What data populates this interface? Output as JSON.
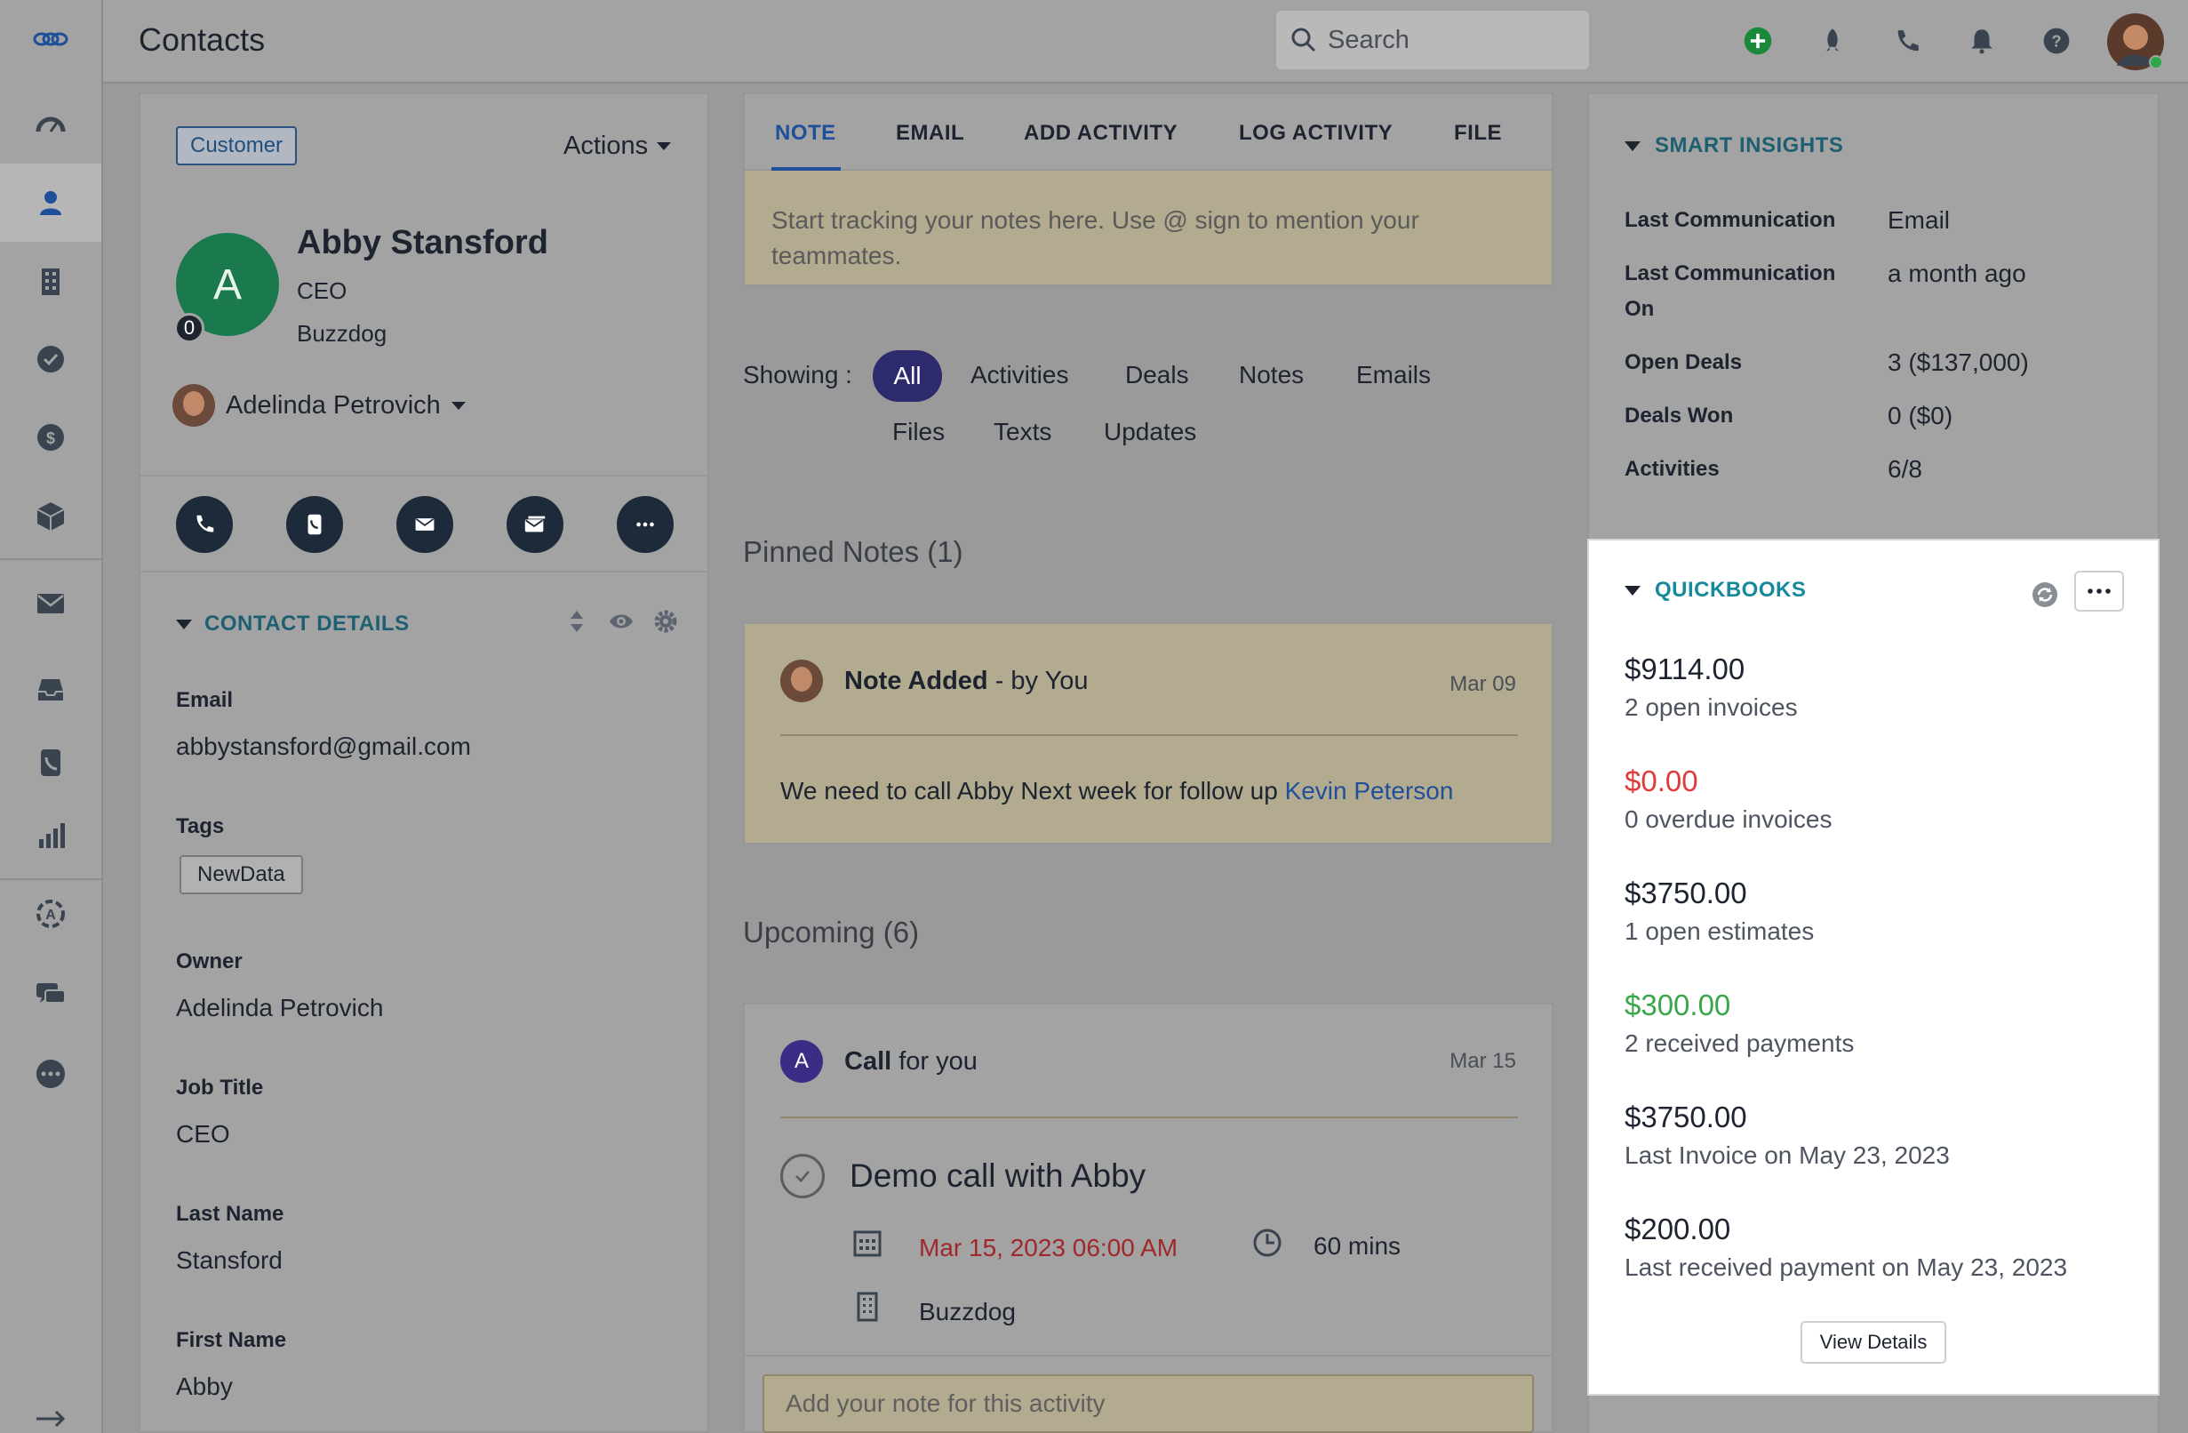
{
  "topbar": {
    "title": "Contacts",
    "search_placeholder": "Search"
  },
  "left_nav": {
    "items": [
      "logo-icon",
      "dashboard-icon",
      "contacts-icon",
      "accounts-icon",
      "tasks-icon",
      "deals-icon",
      "products-icon",
      "email-icon",
      "inbox-icon",
      "phone-log-icon",
      "reports-icon",
      "automation-icon",
      "chat-icon",
      "more-icon",
      "expand-icon"
    ]
  },
  "contact": {
    "badge": "Customer",
    "actions_label": "Actions",
    "avatar_initial": "A",
    "score": "0",
    "name": "Abby Stansford",
    "title": "CEO",
    "company": "Buzzdog",
    "owner": "Adelinda Petrovich"
  },
  "contact_details": {
    "header": "CONTACT DETAILS",
    "email_label": "Email",
    "email": "abbystansford@gmail.com",
    "tags_label": "Tags",
    "tag": "NewData",
    "owner_label": "Owner",
    "owner": "Adelinda Petrovich",
    "job_title_label": "Job Title",
    "job_title": "CEO",
    "last_name_label": "Last Name",
    "last_name": "Stansford",
    "first_name_label": "First Name",
    "first_name": "Abby"
  },
  "composer": {
    "tabs": [
      "NOTE",
      "EMAIL",
      "ADD ACTIVITY",
      "LOG ACTIVITY",
      "FILE"
    ],
    "placeholder_line1": "Start tracking your notes here. Use @ sign to mention your",
    "placeholder_line2": "teammates."
  },
  "filters": {
    "showing_label": "Showing :",
    "items": [
      "All",
      "Activities",
      "Deals",
      "Notes",
      "Emails",
      "Files",
      "Texts",
      "Updates"
    ]
  },
  "pinned": {
    "title": "Pinned Notes (1)",
    "note_title": "Note Added",
    "note_by": " - by You",
    "note_date": "Mar 09",
    "note_text": "We need to call Abby Next week for follow up ",
    "mention": "Kevin Peterson"
  },
  "upcoming": {
    "title": "Upcoming (6)",
    "avatar_initial": "A",
    "type": "Call",
    "for": " for you",
    "date": "Mar 15",
    "activity_title": "Demo call with Abby",
    "datetime": "Mar 15, 2023 06:00 AM",
    "duration": "60 mins",
    "company": "Buzzdog",
    "note_placeholder": "Add your note for this activity"
  },
  "smart_insights": {
    "header": "SMART INSIGHTS",
    "rows": [
      {
        "label": "Last Communication",
        "value": "Email"
      },
      {
        "label": "Last Communication On",
        "value": "a month ago"
      },
      {
        "label": "Open Deals",
        "value": "3 ($137,000)"
      },
      {
        "label": "Deals Won",
        "value": "0 ($0)"
      },
      {
        "label": "Activities",
        "value": "6/8"
      }
    ]
  },
  "quickbooks": {
    "header": "QUICKBOOKS",
    "items": [
      {
        "amount": "$9114.00",
        "desc": "2 open invoices",
        "color": "#1d2430"
      },
      {
        "amount": "$0.00",
        "desc": "0 overdue invoices",
        "color": "#e03a3a"
      },
      {
        "amount": "$3750.00",
        "desc": "1 open estimates",
        "color": "#1d2430"
      },
      {
        "amount": "$300.00",
        "desc": "2 received payments",
        "color": "#3aa64a"
      },
      {
        "amount": "$3750.00",
        "desc": "Last Invoice on May 23, 2023",
        "color": "#1d2430"
      },
      {
        "amount": "$200.00",
        "desc": "Last received payment on May 23, 2023",
        "color": "#1d2430"
      }
    ],
    "view_details": "View Details"
  },
  "colors": {
    "accent": "#1f4f9a",
    "brand_teal": "#16899b",
    "danger": "#e03a3a",
    "success": "#3aa64a",
    "add_button": "#1a8a3a"
  }
}
